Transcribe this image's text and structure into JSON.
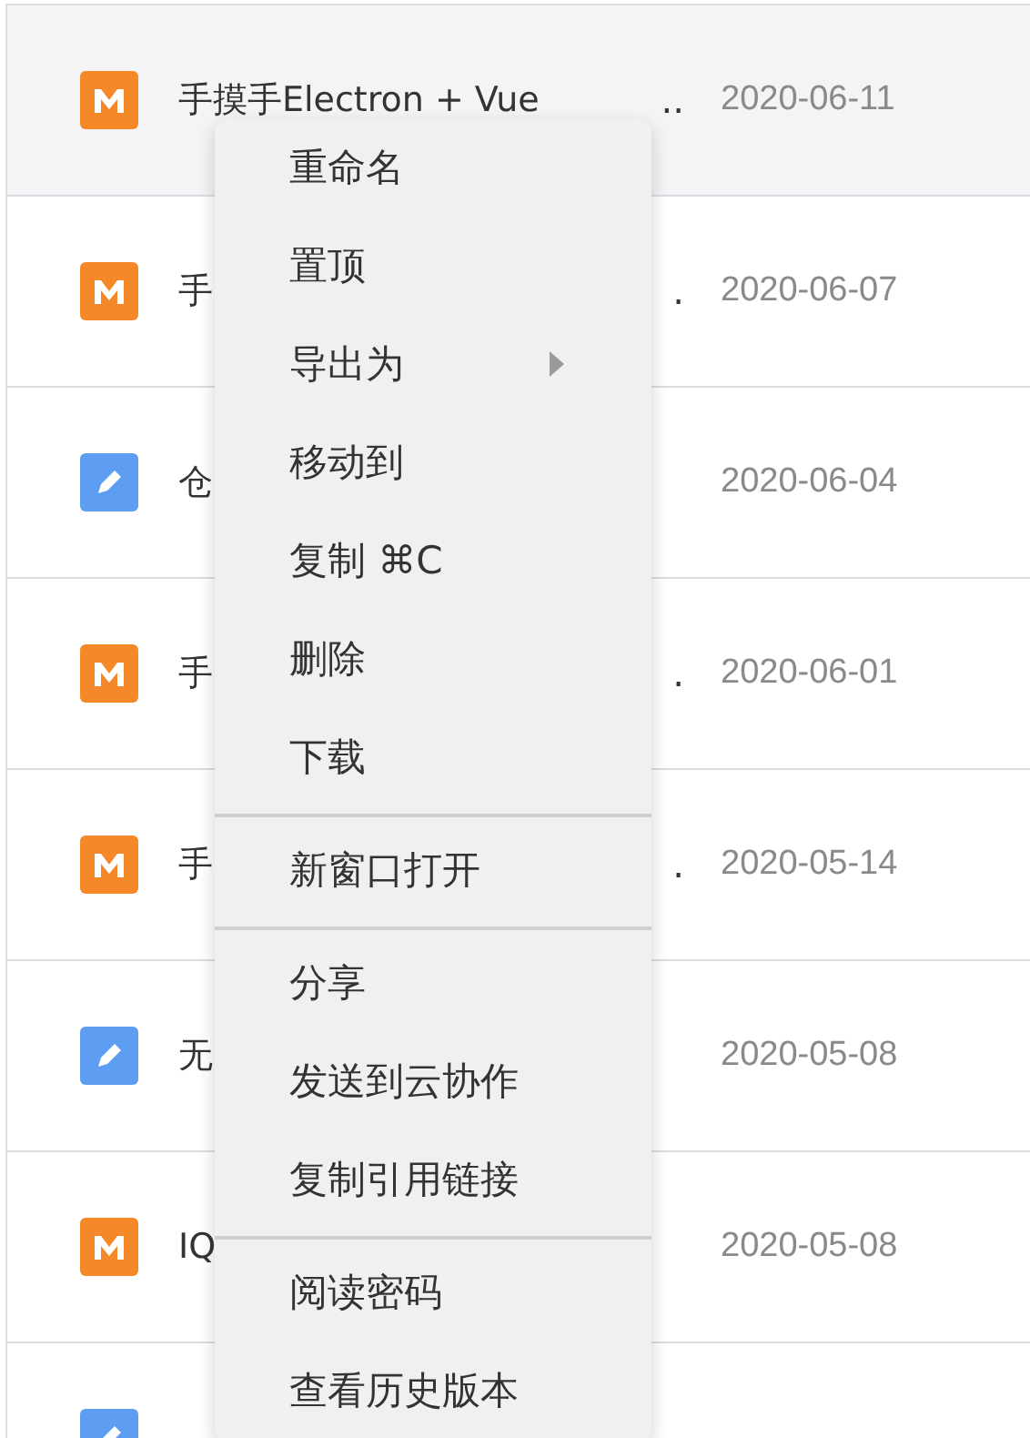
{
  "rows": [
    {
      "kind": "markdown",
      "title": "手摸手Electron + Vue",
      "ellipsis": "..",
      "date": "2020-06-11",
      "selected": true
    },
    {
      "kind": "markdown",
      "title": "手",
      "ellipsis": ".",
      "date": "2020-06-07",
      "selected": false
    },
    {
      "kind": "note",
      "title": "仓",
      "date": "2020-06-04",
      "selected": false
    },
    {
      "kind": "markdown",
      "title": "手",
      "ellipsis": ".",
      "date": "2020-06-01",
      "selected": false
    },
    {
      "kind": "markdown",
      "title": "手",
      "ellipsis": ".",
      "date": "2020-05-14",
      "selected": false
    },
    {
      "kind": "note",
      "title": "无",
      "date": "2020-05-08",
      "selected": false
    },
    {
      "kind": "markdown",
      "title": "IQ",
      "date": "2020-05-08",
      "selected": false
    },
    {
      "kind": "note",
      "selected": false
    }
  ],
  "context_menu": {
    "groups": [
      [
        {
          "label": "重命名",
          "submenu": false
        },
        {
          "label": "置顶",
          "submenu": false
        },
        {
          "label": "导出为",
          "submenu": true
        },
        {
          "label": "移动到",
          "submenu": false
        },
        {
          "label": "复制 ⌘C",
          "submenu": false
        },
        {
          "label": "删除",
          "submenu": false
        },
        {
          "label": "下载",
          "submenu": false
        }
      ],
      [
        {
          "label": "新窗口打开",
          "submenu": false
        }
      ],
      [
        {
          "label": "分享",
          "submenu": false
        },
        {
          "label": "发送到云协作",
          "submenu": false
        },
        {
          "label": "复制引用链接",
          "submenu": false
        }
      ],
      [
        {
          "label": "阅读密码",
          "submenu": false
        },
        {
          "label": "查看历史版本",
          "submenu": false
        }
      ]
    ]
  }
}
